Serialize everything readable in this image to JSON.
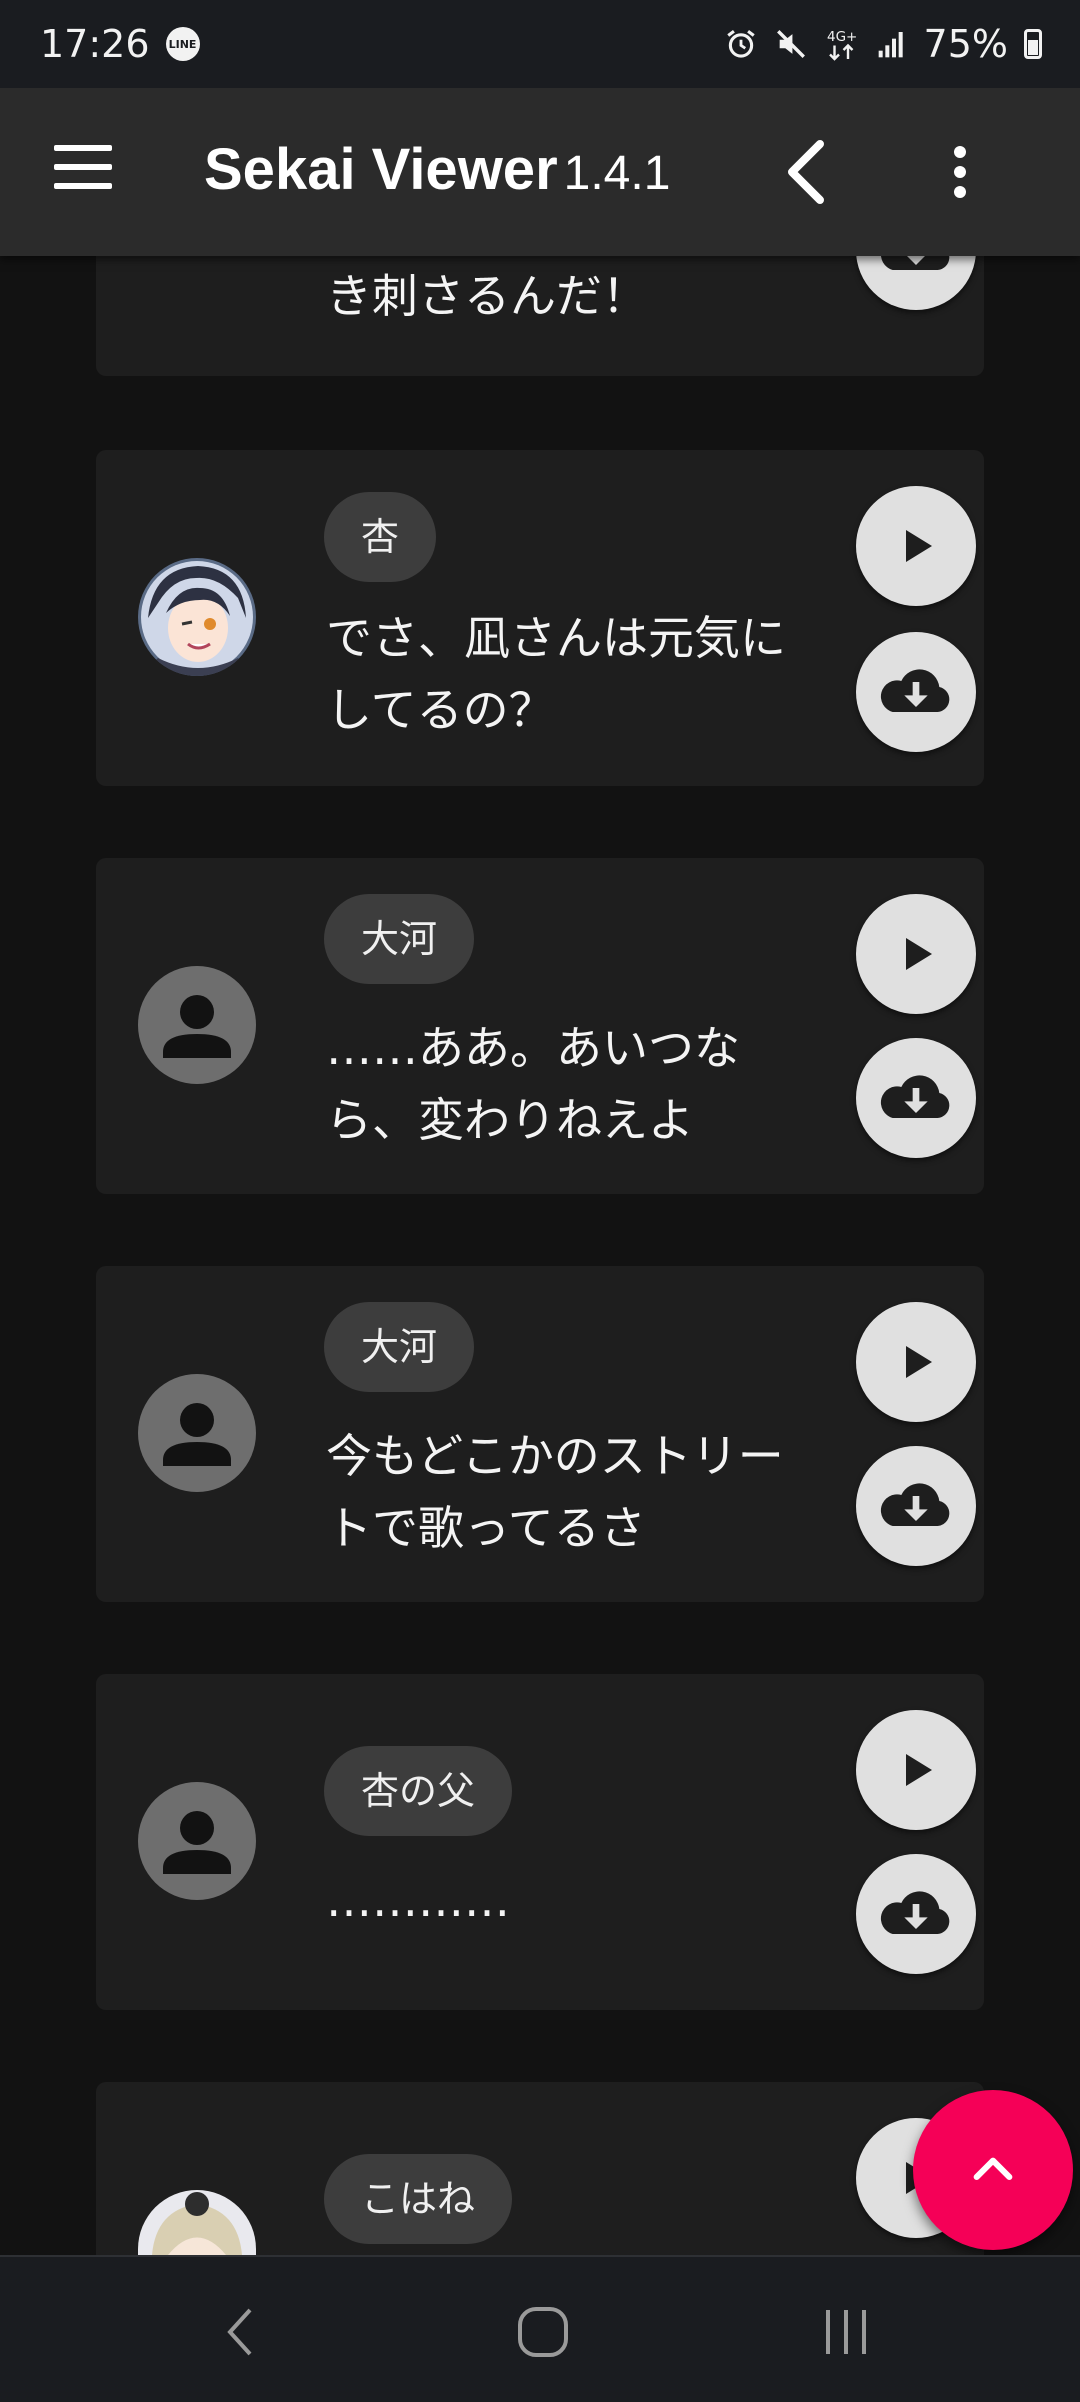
{
  "status_bar": {
    "time": "17:26",
    "line_badge": "LINE",
    "network": "4G+",
    "battery": "75%"
  },
  "app_bar": {
    "title": "Sekai Viewer",
    "version": "1.4.1",
    "icons": [
      "menu-icon",
      "back-icon",
      "more-vert-icon"
    ]
  },
  "dialogs": [
    {
      "name": "",
      "text": "き刺さるんだ！",
      "avatar": "partial"
    },
    {
      "name": "杏",
      "text": "でさ、凪さんは元気にしてるの？",
      "avatar": "character"
    },
    {
      "name": "大河",
      "text": "……ああ。あいつなら、変わりねえよ",
      "avatar": "placeholder"
    },
    {
      "name": "大河",
      "text": "今もどこかのストリートで歌ってるさ",
      "avatar": "placeholder"
    },
    {
      "name": "杏の父",
      "text": "…………",
      "avatar": "placeholder"
    },
    {
      "name": "こはね",
      "text": "",
      "avatar": "character"
    }
  ],
  "colors": {
    "accent": "#f50057",
    "card": "#1e1e1e",
    "chip": "#3d3d3d",
    "button": "#e0e0e0"
  }
}
